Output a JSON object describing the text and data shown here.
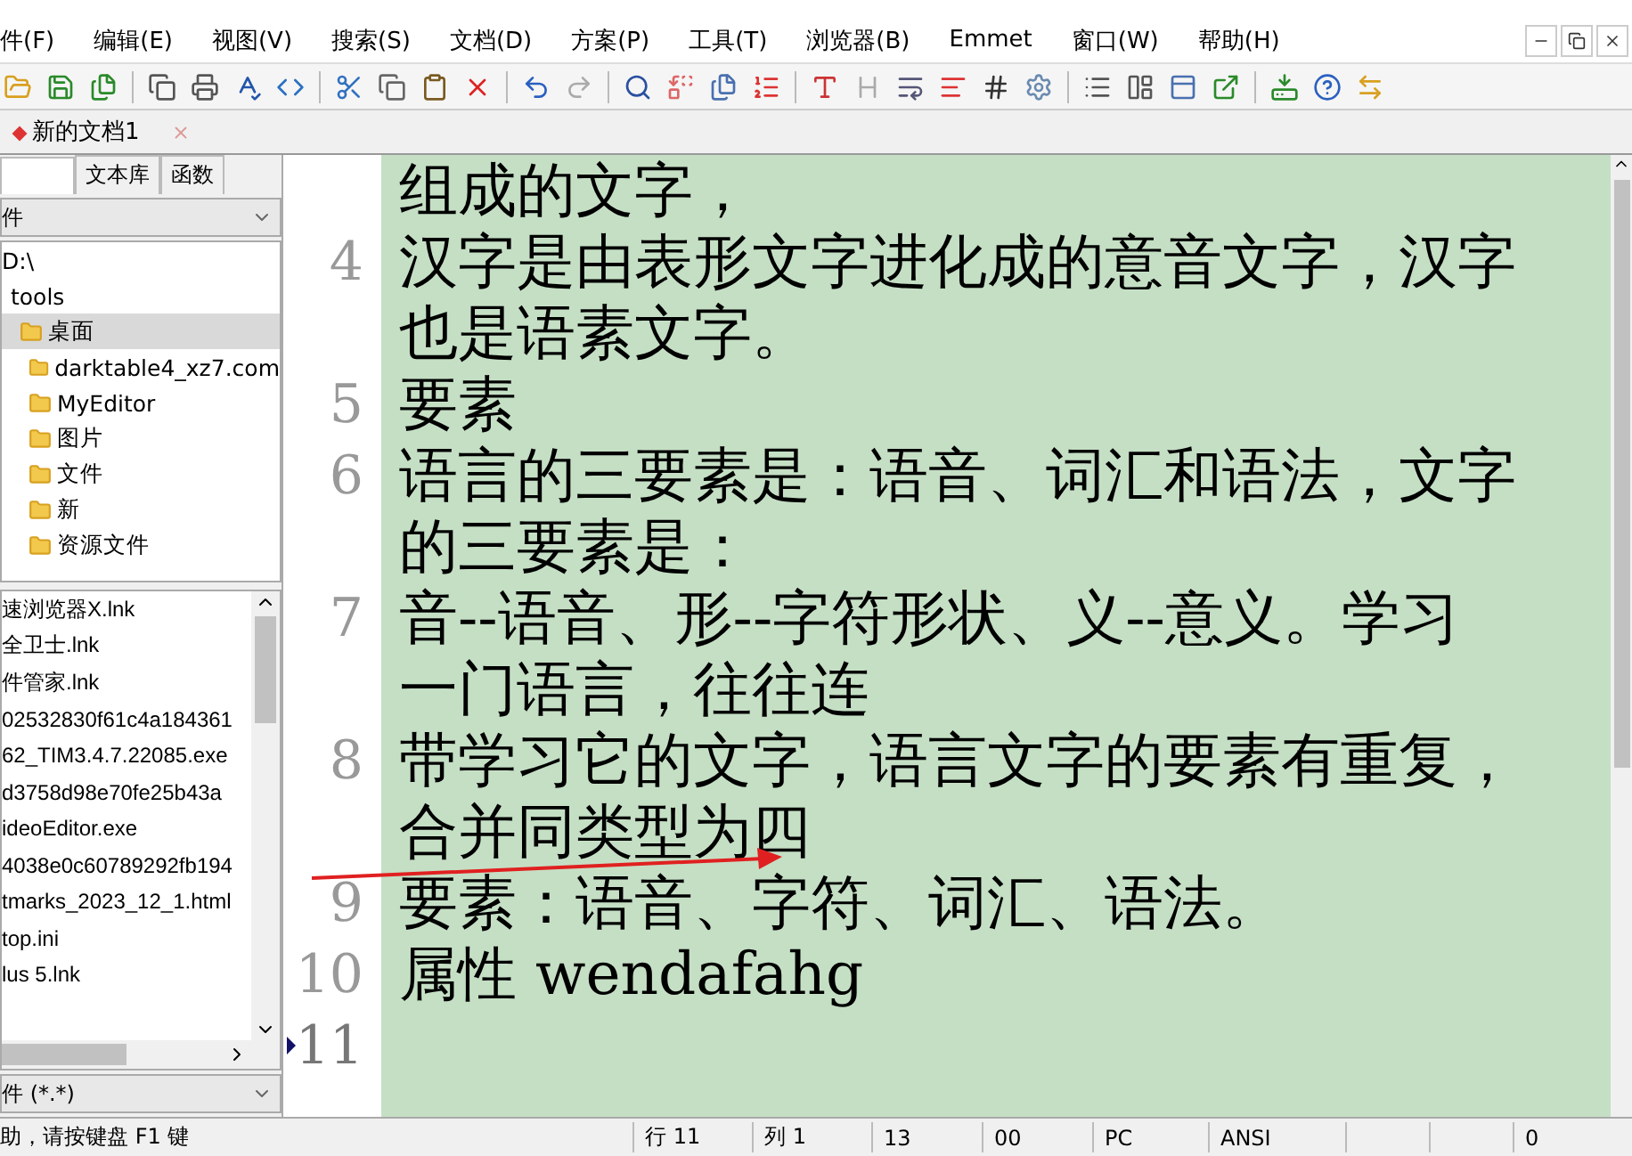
{
  "menu": [
    "件(F)",
    "编辑(E)",
    "视图(V)",
    "搜索(S)",
    "文档(D)",
    "方案(P)",
    "工具(T)",
    "浏览器(B)",
    "Emmet",
    "窗口(W)",
    "帮助(H)"
  ],
  "document_tab": {
    "label": "新的文档1",
    "selected": true
  },
  "sidebar": {
    "tabs": [
      {
        "label": "文本库",
        "selected": false
      },
      {
        "label": "函数",
        "selected": false
      }
    ],
    "folder_dropdown": "件",
    "tree": [
      {
        "label": "D:\\",
        "selected": false,
        "children": [
          {
            "label": "tools",
            "selected": false,
            "children": [
              {
                "label": "桌面",
                "selected": true,
                "children": [
                  {
                    "label": "darktable4_xz7.com",
                    "selected": false
                  },
                  {
                    "label": "MyEditor",
                    "selected": false
                  },
                  {
                    "label": "图片",
                    "selected": false
                  },
                  {
                    "label": "文件",
                    "selected": false
                  },
                  {
                    "label": "新",
                    "selected": false
                  },
                  {
                    "label": "资源文件",
                    "selected": false
                  }
                ]
              }
            ]
          }
        ]
      }
    ],
    "files": [
      "速浏览器X.lnk",
      "全卫士.lnk",
      "件管家.lnk",
      "02532830f61c4a184361",
      "62_TIM3.4.7.22085.exe",
      "d3758d98e70fe25b43a",
      "ideoEditor.exe",
      "4038e0c60789292fb194",
      "tmarks_2023_12_1.html",
      "top.ini",
      "lus 5.lnk"
    ],
    "filter_dropdown": "件 (*.*)"
  },
  "editor": {
    "lines": [
      {
        "current": false,
        "rows": [
          "组成的文字，"
        ]
      },
      {
        "number": "4",
        "current": false,
        "rows": [
          "汉字是由表形文字进化成的意音文字，汉字",
          "也是语素文字。"
        ]
      },
      {
        "number": "5",
        "current": false,
        "rows": [
          "要素"
        ]
      },
      {
        "number": "6",
        "current": false,
        "rows": [
          "语言的三要素是：语音、词汇和语法，文字",
          "的三要素是："
        ]
      },
      {
        "number": "7",
        "current": false,
        "rows": [
          "音--语音、形--字符形状、义--意义。学习",
          "一门语言，往往连"
        ]
      },
      {
        "number": "8",
        "current": false,
        "rows": [
          "带学习它的文字，语言文字的要素有重复，",
          "合并同类型为四"
        ]
      },
      {
        "number": "9",
        "current": false,
        "rows": [
          "要素：语音、字符、词汇、语法。"
        ]
      },
      {
        "number": "10",
        "current": false,
        "rows": [
          "属性 wendafahg"
        ]
      },
      {
        "number": "11",
        "current": true
      }
    ]
  },
  "status_bar": {
    "help": "助，请按键盘 F1 键",
    "cells": [
      "行 11",
      "列 1",
      "13",
      "00",
      "PC",
      "ANSI",
      "0"
    ]
  }
}
